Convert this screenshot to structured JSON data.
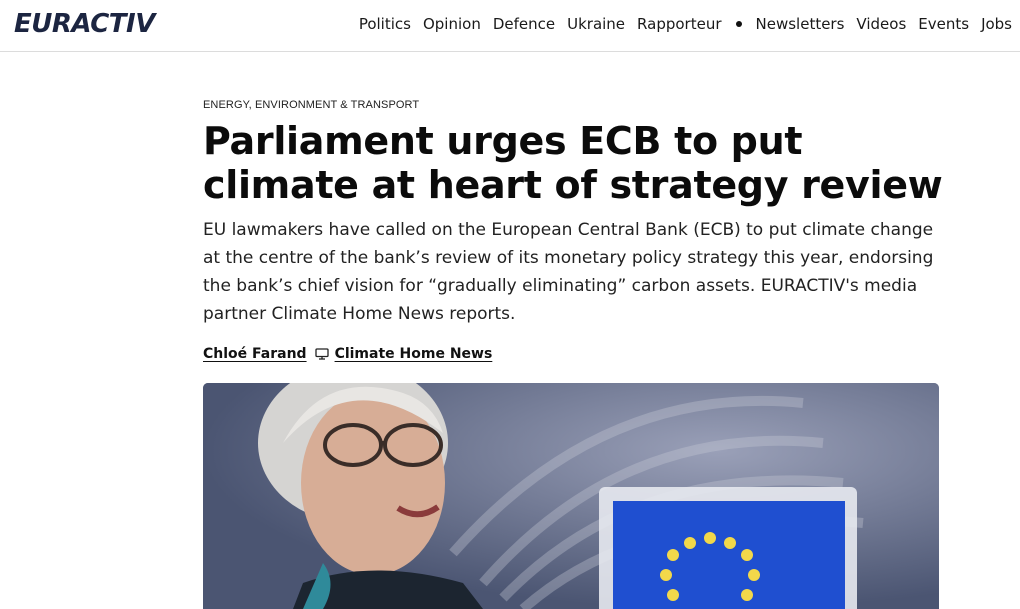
{
  "header": {
    "logo": "EURACTIV",
    "nav": [
      "Politics",
      "Opinion",
      "Defence",
      "Ukraine",
      "Rapporteur",
      "Newsletters",
      "Videos",
      "Events",
      "Jobs"
    ]
  },
  "article": {
    "category": "ENERGY, ENVIRONMENT & TRANSPORT",
    "title": "Parliament urges ECB to put climate at heart of strategy review",
    "lead": "EU lawmakers have called on the European Central Bank (ECB) to put climate change at the centre of the bank’s review of its monetary policy strategy this year, endorsing the bank’s chief vision for “gradually eliminating” carbon assets. EURACTIV's media partner Climate Home News reports.",
    "author": "Chloé Farand",
    "source": "Climate Home News"
  },
  "colors": {
    "logo": "#1c2541",
    "eu_flag_blue": "#1f4fd0",
    "eu_star": "#f2d84a"
  },
  "icons": [
    "monitor-icon"
  ]
}
